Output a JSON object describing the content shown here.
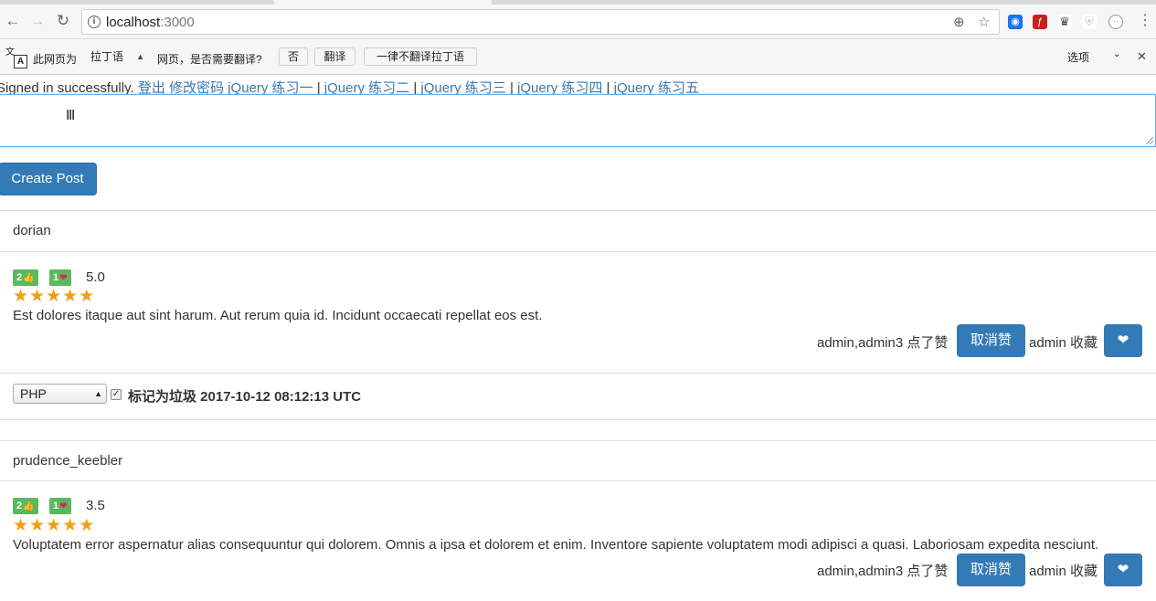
{
  "browser": {
    "url_host": "localhost",
    "url_port": ":3000"
  },
  "translate_bar": {
    "prefix": "此网页为",
    "language": "拉丁语",
    "question": "网页，是否需要翻译?",
    "no_label": "否",
    "translate_label": "翻译",
    "never_label": "一律不翻译拉丁语",
    "options_label": "选项"
  },
  "nav": {
    "signed_message": "Signed in successfully.",
    "links": [
      "登出",
      "修改密码",
      "jQuery 练习一",
      "jQuery 练习二",
      "jQuery 练习三",
      "jQuery 练习四",
      "jQuery 练习五"
    ],
    "separator": "|"
  },
  "create_post_label": "Create Post",
  "posts": [
    {
      "author": "dorian",
      "like_count": "2",
      "heart_count": "1",
      "rating": "5.0",
      "stars": 5,
      "body": "Est dolores itaque aut sint harum. Aut rerum quia id. Incidunt occaecati repellat eos est.",
      "likers": "admin,admin3 点了赞",
      "unlike_label": "取消赞",
      "favoriters": "admin 收藏",
      "category": "PHP",
      "spam_label": "标记为垃圾 2017-10-12 08:12:13 UTC"
    },
    {
      "author": "prudence_keebler",
      "like_count": "2",
      "heart_count": "1",
      "rating": "3.5",
      "stars": 5,
      "body": "Voluptatem error aspernatur alias consequuntur qui dolorem. Omnis a ipsa et dolorem et enim. Inventore sapiente voluptatem modi adipisci a quasi. Laboriosam expedita nesciunt.",
      "likers": "admin,admin3 点了赞",
      "unlike_label": "取消赞",
      "favoriters": "admin 收藏"
    }
  ],
  "icons": {
    "like": "thumbs-up-icon",
    "heart": "heart-icon",
    "star": "star-icon"
  },
  "colors": {
    "primary": "#337ab7",
    "badge_green": "#5cb85c",
    "star": "#f0a00c",
    "link": "#337ab7"
  }
}
